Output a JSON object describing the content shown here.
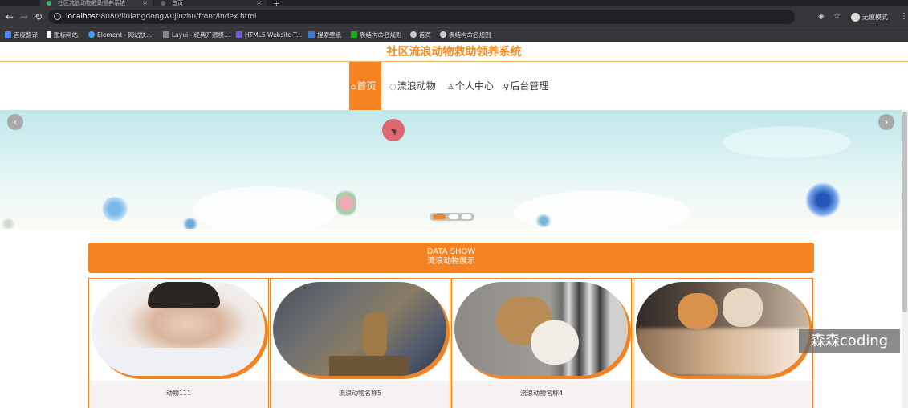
{
  "browser": {
    "tabs": [
      {
        "label": "社区流浪动物救助领养系统"
      },
      {
        "label": "首页"
      }
    ],
    "url_host": "localhost",
    "url_rest": ":8080/liulangdongwujiuzhu/front/index.html",
    "profile_label": "无痕模式",
    "bookmarks": [
      {
        "label": "百度翻译",
        "color": "#4c8bf5"
      },
      {
        "label": "图标网站",
        "color": "#ffffff"
      },
      {
        "label": "Element - 网站快...",
        "color": "#409eff"
      },
      {
        "label": "Layui - 经典开源模...",
        "color": "#cccccc"
      },
      {
        "label": "HTML5 Website T...",
        "color": "#6a5acd"
      },
      {
        "label": "搜索壁纸",
        "color": "#3a7bd5"
      },
      {
        "label": "表结构命名规则",
        "color": "#1aad19"
      },
      {
        "label": "首页",
        "color": "#cccccc"
      },
      {
        "label": "表结构命名规则",
        "color": "#cccccc"
      }
    ]
  },
  "site": {
    "title": "社区流浪动物救助领养系统",
    "nav": [
      {
        "icon": "⌂",
        "label": "首页",
        "active": true
      },
      {
        "icon": "◌",
        "label": "流浪动物",
        "active": false
      },
      {
        "icon": "♙",
        "label": "个人中心",
        "active": false
      },
      {
        "icon": "⚲",
        "label": "后台管理",
        "active": false
      }
    ],
    "carousel": {
      "prev": "‹",
      "next": "›",
      "slide_count": 3,
      "active_index": 0
    }
  },
  "data_show": {
    "title_en": "DATA SHOW",
    "title_cn": "流浪动物展示",
    "items": [
      {
        "name": "动物111"
      },
      {
        "name": "流浪动物名称5"
      },
      {
        "name": "流浪动物名称4"
      },
      {
        "name": ""
      }
    ]
  },
  "watermark": "森森coding",
  "colors": {
    "accent": "#f58220",
    "title": "#f08a1e"
  }
}
